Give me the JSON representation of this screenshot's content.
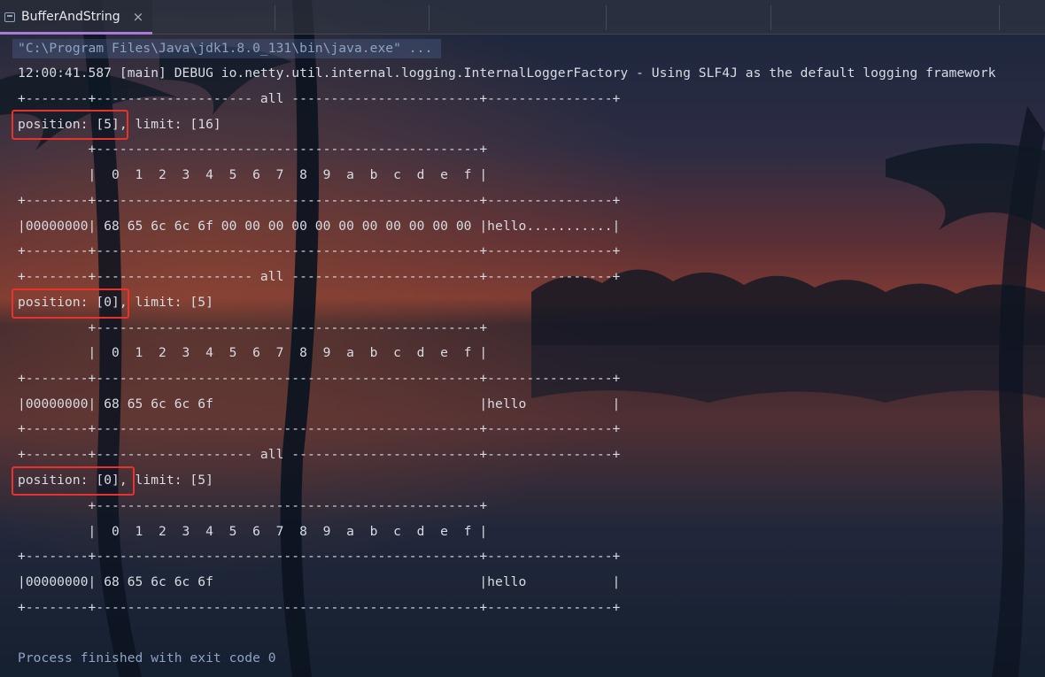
{
  "tab": {
    "title": "BufferAndString",
    "close": "×",
    "icon": "console-icon"
  },
  "console": {
    "command": "\"C:\\Program Files\\Java\\jdk1.8.0_131\\bin\\java.exe\" ...",
    "log": "12:00:41.587 [main] DEBUG io.netty.util.internal.logging.InternalLoggerFactory - Using SLF4J as the default logging framework",
    "dumps": [
      {
        "header": "+--------+-------------------- all ------------------------+----------------+",
        "position": "position: [5],",
        "limit": " limit: [16]",
        "inner_border": "         +-------------------------------------------------+",
        "columns": "         |  0  1  2  3  4  5  6  7  8  9  a  b  c  d  e  f |",
        "sep": "+--------+-------------------------------------------------+----------------+",
        "row": "|00000000| 68 65 6c 6c 6f 00 00 00 00 00 00 00 00 00 00 00 |hello...........|",
        "footer": "+--------+-------------------------------------------------+----------------+"
      },
      {
        "header": "+--------+-------------------- all ------------------------+----------------+",
        "position": "position: [0],",
        "limit": " limit: [5]",
        "inner_border": "         +-------------------------------------------------+",
        "columns": "         |  0  1  2  3  4  5  6  7  8  9  a  b  c  d  e  f |",
        "sep": "+--------+-------------------------------------------------+----------------+",
        "row": "|00000000| 68 65 6c 6c 6f                                  |hello           |",
        "footer": "+--------+-------------------------------------------------+----------------+"
      },
      {
        "header": "+--------+-------------------- all ------------------------+----------------+",
        "position": "position: [0],",
        "limit": " limit: [5]",
        "inner_border": "         +-------------------------------------------------+",
        "columns": "         |  0  1  2  3  4  5  6  7  8  9  a  b  c  d  e  f |",
        "sep": "+--------+-------------------------------------------------+----------------+",
        "row": "|00000000| 68 65 6c 6c 6f                                  |hello           |",
        "footer": "+--------+-------------------------------------------------+----------------+"
      }
    ],
    "exit": "Process finished with exit code 0"
  },
  "colors": {
    "highlight": "#e8322b",
    "tab_accent": "#a97bd6",
    "text": "#d8dce3",
    "muted_text": "#8fa3c4"
  }
}
